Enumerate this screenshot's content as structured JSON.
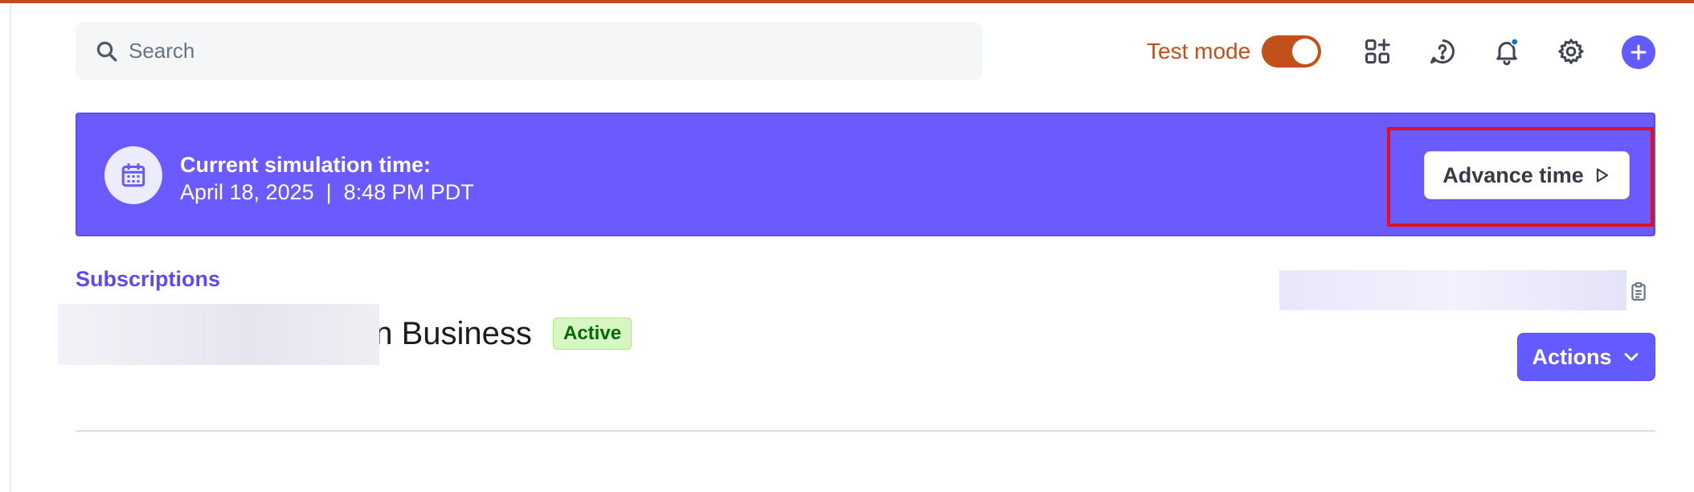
{
  "header": {
    "search_placeholder": "Search",
    "test_mode_label": "Test mode",
    "test_mode_on": true,
    "icons": [
      "search-icon",
      "apps-add-icon",
      "help-icon",
      "bell-icon",
      "gear-icon",
      "plus-icon"
    ]
  },
  "banner": {
    "title": "Current simulation time:",
    "datetime": "April 18, 2025  |  8:48 PM PDT",
    "advance_label": "Advance time"
  },
  "subscription": {
    "breadcrumb": "Subscriptions",
    "title_visible": "on Business",
    "status": "Active",
    "actions_label": "Actions"
  },
  "colors": {
    "accent": "#635bff",
    "test_mode": "#c2501b",
    "banner": "#6b5bff",
    "active_badge": "#d7f7c2"
  }
}
